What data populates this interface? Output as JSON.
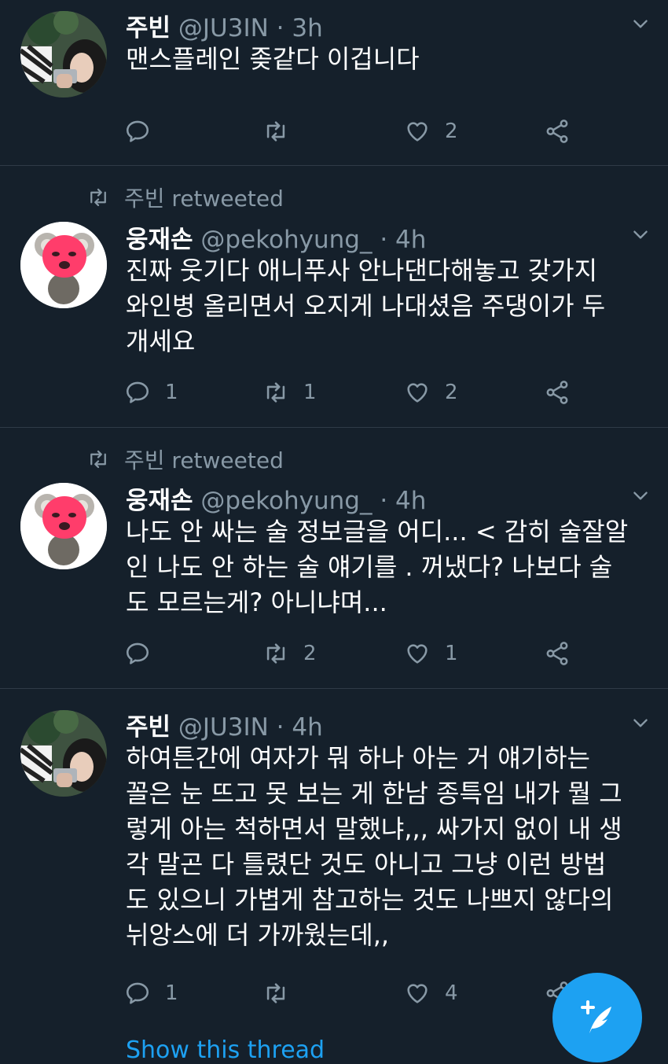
{
  "tweets": [
    {
      "retweeted_by": "",
      "name": "주빈",
      "handle": "@JU3IN",
      "time": "· 3h",
      "lines": [
        "맨스플레인 좆같다 이겁니다"
      ],
      "reply_count": "",
      "retweet_count": "",
      "like_count": "2"
    },
    {
      "retweeted_by": "주빈 retweeted",
      "name": "웅재손",
      "handle": "@pekohyung_",
      "time": "· 4h",
      "lines": [
        "진짜 웃기다 애니푸사 안나댄다해놓고 갖가지",
        "와인병 올리면서 오지게 나대셨음 주댕이가 두",
        "개세요"
      ],
      "reply_count": "1",
      "retweet_count": "1",
      "like_count": "2"
    },
    {
      "retweeted_by": "주빈 retweeted",
      "name": "웅재손",
      "handle": "@pekohyung_",
      "time": "· 4h",
      "lines": [
        "나도 안 싸는 술 정보글을 어디... < 감히 술잘알",
        "인 나도 안 하는 술 얘기를 . 꺼냈다? 나보다 술",
        "도 모르는게? 아니냐며..."
      ],
      "reply_count": "",
      "retweet_count": "2",
      "like_count": "1"
    },
    {
      "retweeted_by": "",
      "name": "주빈",
      "handle": "@JU3IN",
      "time": "· 4h",
      "lines": [
        "하여튼간에 여자가 뭐 하나 아는 거 얘기하는",
        "꼴은 눈 뜨고 못 보는 게 한남 종특임 내가 뭘 그",
        "렇게 아는 척하면서 말했냐,,, 싸가지 없이 내 생",
        "각 말곤 다 틀렸단 것도 아니고 그냥 이런 방법",
        "도 있으니 가볍게 참고하는 것도 나쁘지 않다의",
        "뉘앙스에 더 가까웠는데,,"
      ],
      "reply_count": "1",
      "retweet_count": "",
      "like_count": "4"
    }
  ],
  "show_thread": "Show this thread",
  "colors": {
    "background": "#15202b",
    "secondary": "#8899a6",
    "accent": "#1da1f2"
  }
}
